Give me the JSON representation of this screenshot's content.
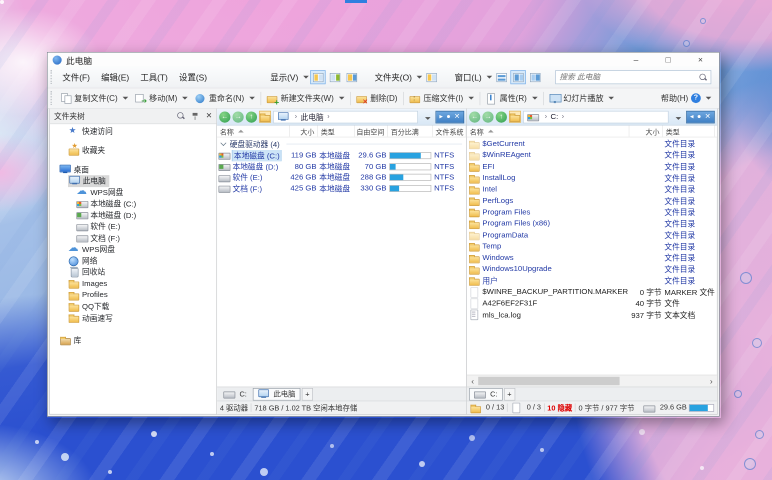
{
  "colors": {
    "accent": "#2f7fe0",
    "item_blue": "#2239a5",
    "hidden_red": "#dd0000",
    "bar_fill": "#28a2e0",
    "selection_gray": "#d8d8d8"
  },
  "window": {
    "title": "此电脑"
  },
  "menubar": {
    "menus": [
      "文件(F)",
      "编辑(E)",
      "工具(T)",
      "设置(S)"
    ],
    "view_label": "显示(V)",
    "folders_label": "文件夹(O)",
    "window_label": "窗口(L)",
    "search_placeholder": "搜索 此电脑"
  },
  "toolbar": {
    "items": [
      {
        "id": "copy",
        "label": "复制文件(C)",
        "dropdown": true,
        "sep": false
      },
      {
        "id": "move",
        "label": "移动(M)",
        "dropdown": true,
        "sep": false
      },
      {
        "id": "rename",
        "label": "重命名(N)",
        "dropdown": true,
        "sep": true
      },
      {
        "id": "newfolder",
        "label": "新建文件夹(W)",
        "dropdown": true,
        "sep": true
      },
      {
        "id": "del",
        "label": "删除(D)",
        "dropdown": false,
        "sep": true
      },
      {
        "id": "zip",
        "label": "压缩文件(I)",
        "dropdown": true,
        "sep": true
      },
      {
        "id": "props",
        "label": "属性(R)",
        "dropdown": true,
        "sep": true
      },
      {
        "id": "slides",
        "label": "幻灯片播放",
        "dropdown": true,
        "sep": false
      }
    ],
    "help_label": "帮助(H)"
  },
  "tree": {
    "header": "文件夹树",
    "items": [
      {
        "id": "quick-access",
        "label": "快速访问",
        "icon": "star",
        "indent": 1,
        "gap": 0
      },
      {
        "id": "favorites",
        "label": "收藏夹",
        "icon": "fav",
        "indent": 1,
        "gap": 11
      },
      {
        "id": "desktop",
        "label": "桌面",
        "icon": "desktop",
        "indent": 0,
        "gap": 11
      },
      {
        "id": "this-pc",
        "label": "此电脑",
        "icon": "computer",
        "indent": 1,
        "gap": 0,
        "selected": true
      },
      {
        "id": "wps-cloud-1",
        "label": "WPS网盘",
        "icon": "cloud",
        "indent": 2,
        "gap": 0
      },
      {
        "id": "disk-c",
        "label": "本地磁盘 (C:)",
        "icon": "drivec",
        "indent": 2,
        "gap": 0
      },
      {
        "id": "disk-d",
        "label": "本地磁盘 (D:)",
        "icon": "drived",
        "indent": 2,
        "gap": 0
      },
      {
        "id": "disk-e",
        "label": "软件 (E:)",
        "icon": "drive",
        "indent": 2,
        "gap": 0
      },
      {
        "id": "disk-f",
        "label": "文档 (F:)",
        "icon": "drive",
        "indent": 2,
        "gap": 0
      },
      {
        "id": "wps-cloud-2",
        "label": "WPS网盘",
        "icon": "cloud",
        "indent": 1,
        "gap": 0
      },
      {
        "id": "network",
        "label": "网络",
        "icon": "net",
        "indent": 1,
        "gap": 0
      },
      {
        "id": "recycle-bin",
        "label": "回收站",
        "icon": "bin",
        "indent": 1,
        "gap": 0
      },
      {
        "id": "images",
        "label": "Images",
        "icon": "folder",
        "indent": 1,
        "gap": 0
      },
      {
        "id": "profiles",
        "label": "Profiles",
        "icon": "folder",
        "indent": 1,
        "gap": 0
      },
      {
        "id": "qq-download",
        "label": "QQ下载",
        "icon": "folder",
        "indent": 1,
        "gap": 0
      },
      {
        "id": "anim-sketch",
        "label": "动画速写",
        "icon": "folder",
        "indent": 1,
        "gap": 0
      },
      {
        "id": "libraries",
        "label": "库",
        "icon": "lib",
        "indent": 0,
        "gap": 16
      }
    ]
  },
  "middle_panel": {
    "breadcrumb": "此电脑",
    "columns": [
      "名称",
      "大小",
      "类型",
      "自由空间",
      "百分比满",
      "文件系统"
    ],
    "group_label": "硬盘驱动器 (4)",
    "rows": [
      {
        "name": "本地磁盘 (C:)",
        "icon": "drivec",
        "size": "119 GB",
        "type": "本地磁盘",
        "free": "29.6 GB",
        "percent_used": 75,
        "fs": "NTFS",
        "selected": true
      },
      {
        "name": "本地磁盘 (D:)",
        "icon": "drived",
        "size": "80 GB",
        "type": "本地磁盘",
        "free": "70 GB",
        "percent_used": 13,
        "fs": "NTFS",
        "selected": false
      },
      {
        "name": "软件 (E:)",
        "icon": "drive",
        "size": "426 GB",
        "type": "本地磁盘",
        "free": "288 GB",
        "percent_used": 32,
        "fs": "NTFS",
        "selected": false
      },
      {
        "name": "文档 (F:)",
        "icon": "drive",
        "size": "425 GB",
        "type": "本地磁盘",
        "free": "330 GB",
        "percent_used": 22,
        "fs": "NTFS",
        "selected": false
      }
    ],
    "tabs": [
      {
        "label": "C:",
        "icon": "drivetab",
        "active": false
      },
      {
        "label": "此电脑",
        "icon": "computer",
        "active": true
      }
    ],
    "status_left": "4 驱动器",
    "status_right": "718 GB / 1.02 TB 空闲本地存储"
  },
  "right_panel": {
    "breadcrumb": "C:",
    "columns": [
      "名称",
      "大小",
      "类型"
    ],
    "rows": [
      {
        "name": "$GetCurrent",
        "icon": "folder",
        "faded": true,
        "size": "",
        "type": "文件目录",
        "is_file": false
      },
      {
        "name": "$WinREAgent",
        "icon": "folder",
        "faded": true,
        "size": "",
        "type": "文件目录",
        "is_file": false
      },
      {
        "name": "EFI",
        "icon": "folder",
        "faded": false,
        "size": "",
        "type": "文件目录",
        "is_file": false
      },
      {
        "name": "InstallLog",
        "icon": "folder",
        "faded": false,
        "size": "",
        "type": "文件目录",
        "is_file": false
      },
      {
        "name": "Intel",
        "icon": "folder",
        "faded": false,
        "size": "",
        "type": "文件目录",
        "is_file": false
      },
      {
        "name": "PerfLogs",
        "icon": "folder",
        "faded": false,
        "size": "",
        "type": "文件目录",
        "is_file": false
      },
      {
        "name": "Program Files",
        "icon": "folder",
        "faded": false,
        "size": "",
        "type": "文件目录",
        "is_file": false
      },
      {
        "name": "Program Files (x86)",
        "icon": "folder",
        "faded": false,
        "size": "",
        "type": "文件目录",
        "is_file": false
      },
      {
        "name": "ProgramData",
        "icon": "folder",
        "faded": true,
        "size": "",
        "type": "文件目录",
        "is_file": false
      },
      {
        "name": "Temp",
        "icon": "folder",
        "faded": false,
        "size": "",
        "type": "文件目录",
        "is_file": false
      },
      {
        "name": "Windows",
        "icon": "folder",
        "faded": false,
        "size": "",
        "type": "文件目录",
        "is_file": false
      },
      {
        "name": "Windows10Upgrade",
        "icon": "folder",
        "faded": false,
        "size": "",
        "type": "文件目录",
        "is_file": false
      },
      {
        "name": "用户",
        "icon": "folder",
        "faded": false,
        "size": "",
        "type": "文件目录",
        "is_file": false
      },
      {
        "name": "$WINRE_BACKUP_PARTITION.MARKER",
        "icon": "page",
        "faded": true,
        "size": "0 字节",
        "type": "MARKER 文件",
        "is_file": true
      },
      {
        "name": "A42F6EF2F31F",
        "icon": "page",
        "faded": true,
        "size": "40 字节",
        "type": "文件",
        "is_file": true
      },
      {
        "name": "mls_lca.log",
        "icon": "log",
        "faded": false,
        "size": "937 字节",
        "type": "文本文档",
        "is_file": true
      }
    ],
    "tabs": [
      {
        "label": "C:",
        "icon": "drivetab",
        "active": true
      }
    ],
    "status": {
      "folders": "0 / 13",
      "files": "0 / 3",
      "hidden": "10 隐藏",
      "bytes": "0 字节 / 977 字节",
      "free": "29.6 GB",
      "free_percent": 75
    }
  }
}
